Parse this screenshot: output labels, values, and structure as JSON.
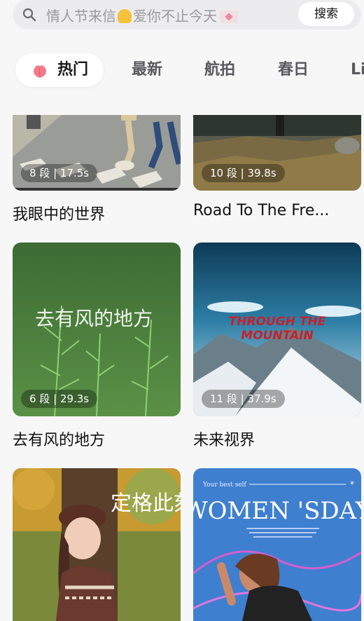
{
  "search": {
    "placeholder_before": "情人节来信",
    "placeholder_after": "爱你不止今天",
    "button_label": "搜索"
  },
  "tabs": [
    {
      "label": "热门",
      "active": true
    },
    {
      "label": "最新"
    },
    {
      "label": "航拍"
    },
    {
      "label": "春日"
    },
    {
      "label": "Li"
    }
  ],
  "cards": [
    {
      "badge": "8 段 | 17.5s",
      "title": "我眼中的世界"
    },
    {
      "badge": "10 段 | 39.8s",
      "title": "Road To The Fre..."
    },
    {
      "badge": "6 段 | 29.3s",
      "title": "去有风的地方",
      "overlay_text": "去有风的地方"
    },
    {
      "badge": "11 段 | 37.9s",
      "title": "未来视界",
      "overlay_text": "THROUGH THE MOUNTAIN"
    },
    {
      "overlay_text": "定格此刻"
    },
    {
      "overlay_text": "WOMEN 'SDAY",
      "overlay_small": "Your best self"
    }
  ],
  "colors": {
    "accent_peach": "#f47a8a",
    "badge_bg": "rgba(0,0,0,0.32)"
  }
}
